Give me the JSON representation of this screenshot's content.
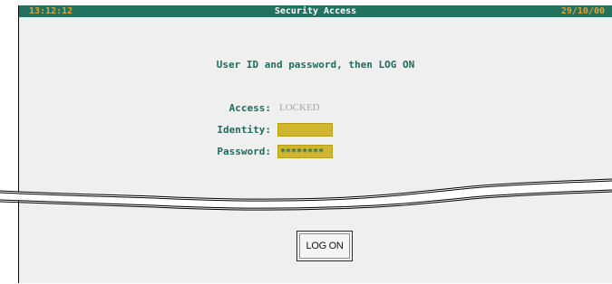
{
  "titlebar": {
    "time": "13:12:12",
    "title": "Security Access",
    "date": "29/10/00"
  },
  "instruction": "User ID and password, then LOG ON",
  "form": {
    "access_label": "Access:",
    "access_value": "LOCKED",
    "identity_label": "Identity:",
    "identity_value": "",
    "password_label": "Password:",
    "password_value": "********"
  },
  "logon_button": "LOG ON",
  "colors": {
    "titlebar": "#23715f",
    "accent_text": "#1f6b5c",
    "clock_text": "#e6a12a",
    "field_fill": "#d1b52d",
    "panel_bg": "#efefef"
  }
}
